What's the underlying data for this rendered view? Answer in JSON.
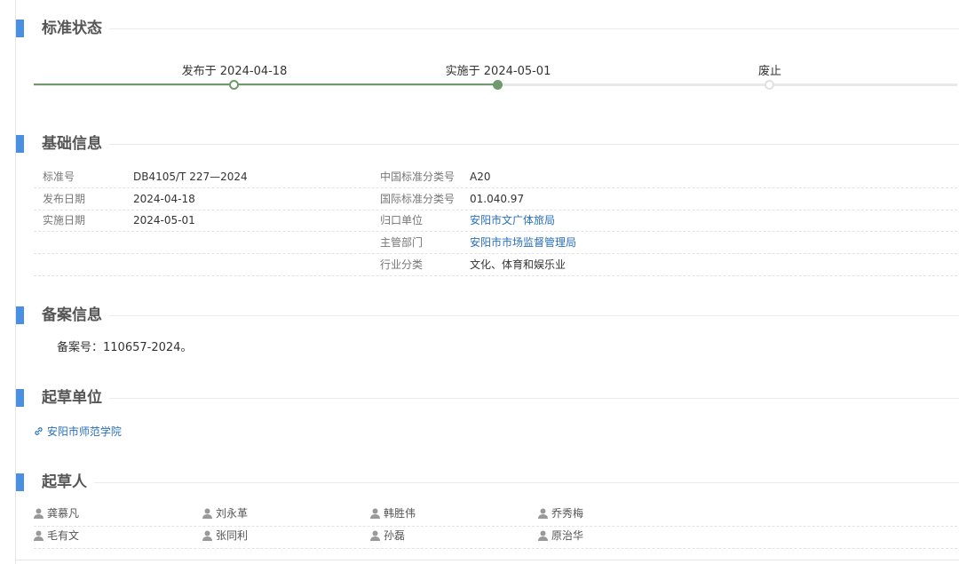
{
  "status": {
    "title": "标准状态",
    "steps": [
      {
        "label": "发布于 2024-04-18",
        "state": "done-hollow"
      },
      {
        "label": "实施于 2024-05-01",
        "state": "current"
      },
      {
        "label": "废止",
        "state": "pending"
      }
    ],
    "colors": {
      "done": "#6e9a6e",
      "pending": "#e0e0e0"
    }
  },
  "basic": {
    "title": "基础信息",
    "left": [
      {
        "label": "标准号",
        "value": "DB4105/T 227—2024"
      },
      {
        "label": "发布日期",
        "value": "2024-04-18"
      },
      {
        "label": "实施日期",
        "value": "2024-05-01"
      }
    ],
    "right": [
      {
        "label": "中国标准分类号",
        "value": "A20",
        "link": false
      },
      {
        "label": "国际标准分类号",
        "value": "01.040.97",
        "link": false
      },
      {
        "label": "归口单位",
        "value": "安阳市文广体旅局",
        "link": true
      },
      {
        "label": "主管部门",
        "value": "安阳市市场监督管理局",
        "link": true
      },
      {
        "label": "行业分类",
        "value": "文化、体育和娱乐业",
        "link": false
      }
    ]
  },
  "filing": {
    "title": "备案信息",
    "text": "备案号：110657-2024。"
  },
  "drafting_unit": {
    "title": "起草单位",
    "unit": "安阳市师范学院",
    "icon": "link-icon"
  },
  "drafters": {
    "title": "起草人",
    "icon": "person-icon",
    "rows": [
      [
        "龚慕凡",
        "刘永革",
        "韩胜伟",
        "乔秀梅"
      ],
      [
        "毛有文",
        "张同利",
        "孙磊",
        "原治华"
      ]
    ]
  },
  "accent_color": "#4a90e2",
  "link_color": "#2a6fb7"
}
